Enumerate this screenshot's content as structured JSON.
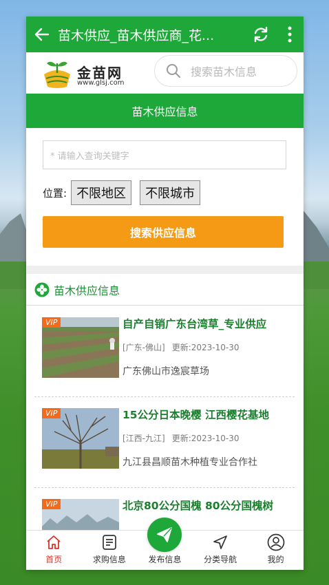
{
  "appbar": {
    "title": "苗木供应_苗木供应商_花...",
    "back_icon": "back-arrow-icon",
    "refresh_icon": "refresh-icon",
    "more_icon": "more-vertical-icon"
  },
  "header": {
    "logo_brand": "金苗网",
    "logo_url": "www.glsj.com",
    "search_placeholder": "搜索苗木信息"
  },
  "form": {
    "banner": "苗木供应信息",
    "keyword_placeholder": "* 请输入查询关键字",
    "location_label": "位置:",
    "region_value": "不限地区",
    "city_value": "不限城市",
    "search_button": "搜索供应信息"
  },
  "list": {
    "title": "苗木供应信息",
    "items": [
      {
        "vip": "VIP",
        "title": "自产自销广东台湾草_专业供应",
        "location": "[广东-佛山]",
        "updated": "更新:2023-10-30",
        "company": "广东佛山市逸宸草场"
      },
      {
        "vip": "VIP",
        "title": "15公分日本晚樱 江西樱花基地",
        "location": "[江西-九江]",
        "updated": "更新:2023-10-30",
        "company": "九江县昌顺苗木种植专业合作社"
      },
      {
        "vip": "VIP",
        "title": "北京80公分国槐 80公分国槐树",
        "location": "",
        "updated": "",
        "company": ""
      }
    ]
  },
  "tabbar": {
    "items": [
      {
        "label": "首页",
        "icon": "home-icon"
      },
      {
        "label": "求购信息",
        "icon": "document-icon"
      },
      {
        "label": "发布信息",
        "icon": "send-icon"
      },
      {
        "label": "分类导航",
        "icon": "navigation-icon"
      },
      {
        "label": "我的",
        "icon": "user-icon"
      }
    ]
  },
  "colors": {
    "primary_green": "#1fa83a",
    "accent_orange": "#f59a14",
    "vip_orange": "#f26a1b",
    "active_tab_red": "#d8342b"
  }
}
